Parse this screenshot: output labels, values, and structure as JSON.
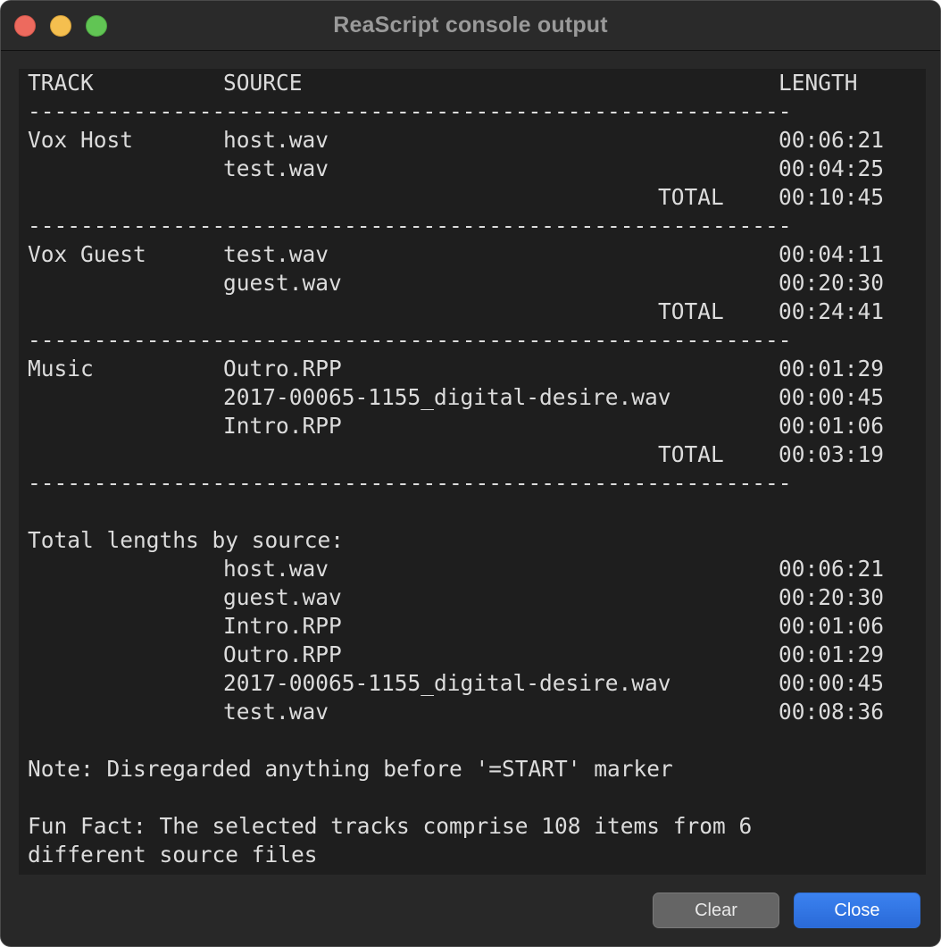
{
  "window": {
    "title": "ReaScript console output",
    "traffic_lights": {
      "close": {
        "icon": "close-icon",
        "color": "#ed6a5e"
      },
      "minimize": {
        "icon": "minimize-icon",
        "color": "#f5bf4f"
      },
      "zoom": {
        "icon": "zoom-icon",
        "color": "#61c554"
      }
    }
  },
  "console": {
    "header": {
      "track": "TRACK",
      "source": "SOURCE",
      "length": "LENGTH"
    },
    "separator": "----------------------------------------------------------",
    "total_label": "TOTAL",
    "groups": [
      {
        "track": "Vox Host",
        "items": [
          {
            "source": "host.wav",
            "length": "00:06:21"
          },
          {
            "source": "test.wav",
            "length": "00:04:25"
          }
        ],
        "total": "00:10:45"
      },
      {
        "track": "Vox Guest",
        "items": [
          {
            "source": "test.wav",
            "length": "00:04:11"
          },
          {
            "source": "guest.wav",
            "length": "00:20:30"
          }
        ],
        "total": "00:24:41"
      },
      {
        "track": "Music",
        "items": [
          {
            "source": "Outro.RPP",
            "length": "00:01:29"
          },
          {
            "source": "2017-00065-1155_digital-desire.wav",
            "length": "00:00:45"
          },
          {
            "source": "Intro.RPP",
            "length": "00:01:06"
          }
        ],
        "total": "00:03:19"
      }
    ],
    "by_source_heading": "Total lengths by source:",
    "by_source": [
      {
        "source": "host.wav",
        "length": "00:06:21"
      },
      {
        "source": "guest.wav",
        "length": "00:20:30"
      },
      {
        "source": "Intro.RPP",
        "length": "00:01:06"
      },
      {
        "source": "Outro.RPP",
        "length": "00:01:29"
      },
      {
        "source": "2017-00065-1155_digital-desire.wav",
        "length": "00:00:45"
      },
      {
        "source": "test.wav",
        "length": "00:08:36"
      }
    ],
    "note": "Note: Disregarded anything before '=START' marker",
    "fun_fact_line1": "Fun Fact: The selected tracks comprise 108 items from 6",
    "fun_fact_line2": "different source files"
  },
  "buttons": {
    "clear_label": "Clear",
    "close_label": "Close"
  }
}
